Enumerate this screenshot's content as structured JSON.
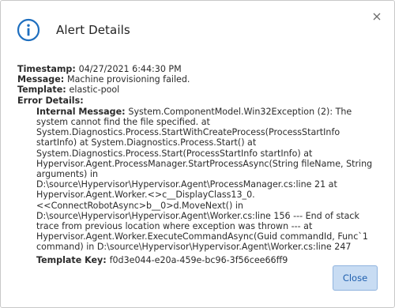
{
  "dialog": {
    "title": "Alert Details",
    "close_button_label": "Close"
  },
  "colors": {
    "accent": "#1f6fbf",
    "button_bg": "#c8dcf3",
    "button_border": "#8fb3de"
  },
  "icons": {
    "header": "info-icon",
    "dismiss": "close-icon"
  },
  "details": {
    "timestamp_label": "Timestamp",
    "timestamp_value": "04/27/2021 6:44:30 PM",
    "message_label": "Message",
    "message_value": "Machine provisioning failed.",
    "template_label": "Template",
    "template_value": "elastic-pool",
    "error_details_label": "Error Details:",
    "internal_message_label": "Internal Message",
    "internal_message_value": "System.ComponentModel.Win32Exception (2): The system cannot find the file specified. at System.Diagnostics.Process.StartWithCreateProcess(ProcessStartInfo startInfo) at System.Diagnostics.Process.Start() at System.Diagnostics.Process.Start(ProcessStartInfo startInfo) at Hypervisor.Agent.ProcessManager.StartProcessAsync(String fileName, String arguments) in D:\\source\\Hypervisor\\Hypervisor.Agent\\ProcessManager.cs:line 21 at Hypervisor.Agent.Worker.<>c__DisplayClass13_0.<<ConnectRobotAsync>b__0>d.MoveNext() in D:\\source\\Hypervisor\\Hypervisor.Agent\\Worker.cs:line 156 --- End of stack trace from previous location where exception was thrown --- at Hypervisor.Agent.Worker.ExecuteCommandAsync(Guid commandId, Func`1 command) in D:\\source\\Hypervisor\\Hypervisor.Agent\\Worker.cs:line 247",
    "template_key_label": "Template Key",
    "template_key_value": "f0d3e044-e20a-459e-bc96-3f56cee66ff9"
  }
}
